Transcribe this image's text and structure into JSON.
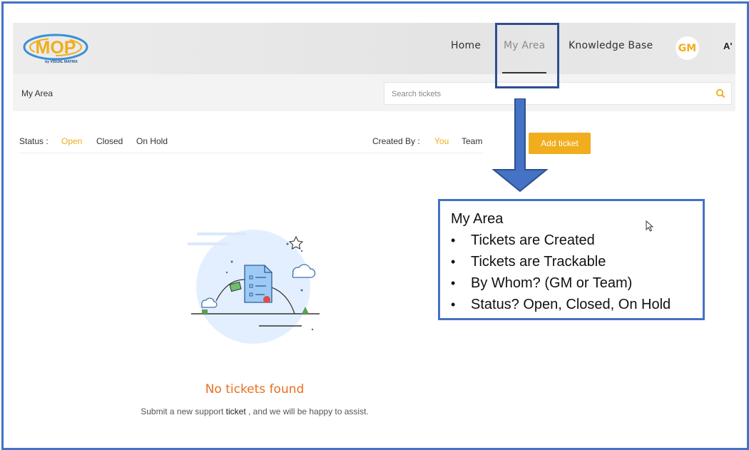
{
  "brand": {
    "logo_text": "MOP",
    "logo_sub": "by VISUAL MATRIX"
  },
  "nav": {
    "home": "Home",
    "my_area": "My Area",
    "knowledge_base": "Knowledge Base",
    "avatar_initials": "GM",
    "font_toggle": "A'"
  },
  "subbar": {
    "breadcrumb": "My Area",
    "search_placeholder": "Search tickets"
  },
  "filters": {
    "status_label": "Status :",
    "status_options": [
      "Open",
      "Closed",
      "On Hold"
    ],
    "status_selected": "Open",
    "created_by_label": "Created By :",
    "created_by_options": [
      "You",
      "Team"
    ],
    "created_by_selected": "You",
    "add_ticket": "Add ticket"
  },
  "empty_state": {
    "title": "No tickets found",
    "sub_before": "Submit a new support",
    "sub_bold": "ticket",
    "sub_after": ", and we will be happy to assist."
  },
  "callout": {
    "title": "My Area",
    "bullets": [
      "Tickets are Created",
      "Tickets are Trackable",
      "By Whom? (GM or Team)",
      "Status? Open, Closed, On Hold"
    ]
  },
  "colors": {
    "accent": "#f0ad1e",
    "empty_title": "#e8701e",
    "frame_border": "#4472c4",
    "highlight_border": "#2f4f8f"
  },
  "icons": [
    "search-icon",
    "document-icon",
    "cloud-icon",
    "star-icon",
    "cursor-icon",
    "down-arrow-icon"
  ]
}
